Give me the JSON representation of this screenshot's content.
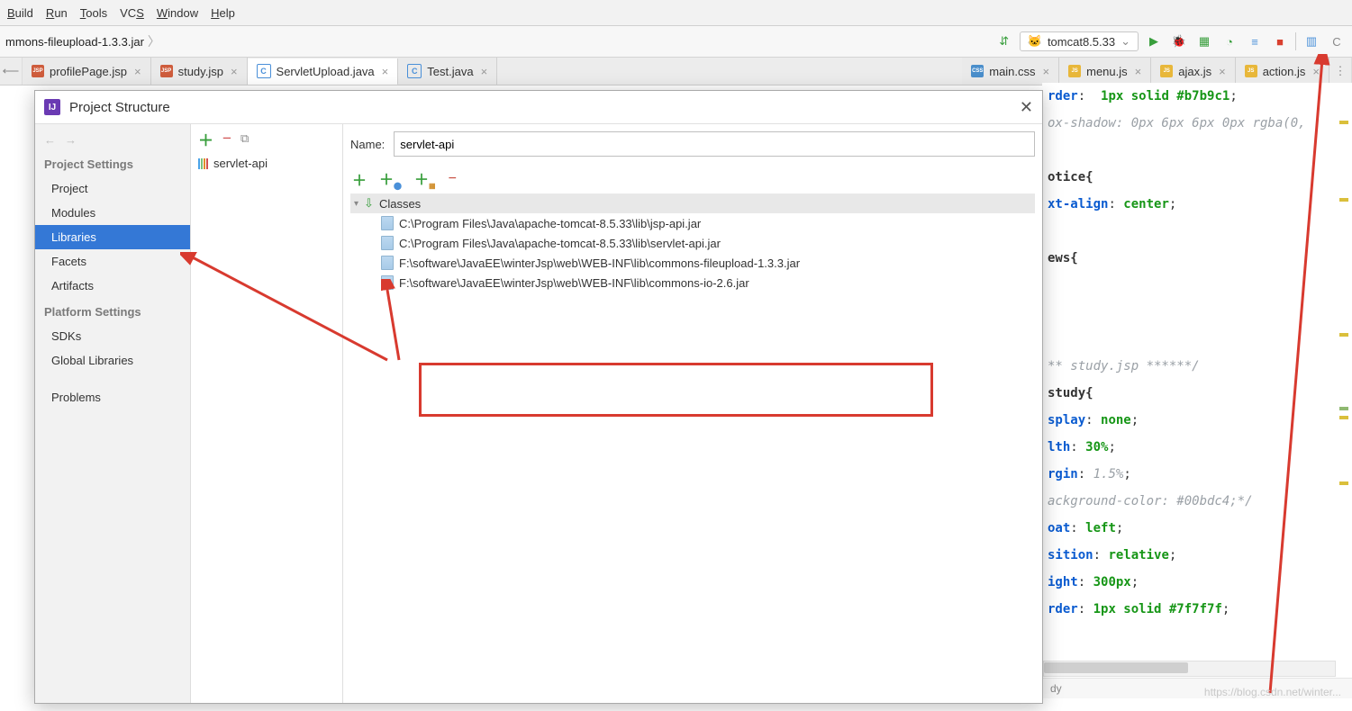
{
  "menu": {
    "items": [
      "Build",
      "Run",
      "Tools",
      "VCS",
      "Window",
      "Help"
    ]
  },
  "breadcrumb": {
    "segment": "mmons-fileupload-1.3.3.jar"
  },
  "runConfig": {
    "label": "tomcat8.5.33"
  },
  "tabs": [
    {
      "label": "profilePage.jsp",
      "type": "jsp",
      "active": false
    },
    {
      "label": "study.jsp",
      "type": "jsp",
      "active": false
    },
    {
      "label": "ServletUpload.java",
      "type": "java",
      "active": true
    },
    {
      "label": "Test.java",
      "type": "java",
      "active": false
    },
    {
      "label": "main.css",
      "type": "css",
      "active": false
    },
    {
      "label": "menu.js",
      "type": "js",
      "active": false
    },
    {
      "label": "ajax.js",
      "type": "js",
      "active": false
    },
    {
      "label": "action.js",
      "type": "js",
      "active": false
    }
  ],
  "editor": {
    "lines": [
      {
        "t": "css",
        "txt": "rder:  1px solid #b7b9c1;"
      },
      {
        "t": "com",
        "txt": "ox-shadow: 0px 6px 6px 0px rgba(0,"
      },
      {
        "t": "blank",
        "txt": ""
      },
      {
        "t": "sel",
        "txt": "otice{"
      },
      {
        "t": "css",
        "txt": "xt-align: center;"
      },
      {
        "t": "blank",
        "txt": ""
      },
      {
        "t": "sel",
        "txt": "ews{"
      },
      {
        "t": "blank",
        "txt": ""
      },
      {
        "t": "blank",
        "txt": ""
      },
      {
        "t": "blank",
        "txt": ""
      },
      {
        "t": "com",
        "txt": "** study.jsp ******/"
      },
      {
        "t": "sel",
        "txt": "study{"
      },
      {
        "t": "css",
        "txt": "splay: none;"
      },
      {
        "t": "css",
        "txt": "lth: 30%;"
      },
      {
        "t": "cssi",
        "txt": "rgin: 1.5%;"
      },
      {
        "t": "com",
        "txt": "ackground-color: #00bdc4;*/"
      },
      {
        "t": "css",
        "txt": "oat: left;"
      },
      {
        "t": "csshl",
        "txt": "sition: relative;"
      },
      {
        "t": "css",
        "txt": "ight: 300px;"
      },
      {
        "t": "css",
        "txt": "rder: 1px solid #7f7f7f;"
      }
    ],
    "status": "dy"
  },
  "dialog": {
    "title": "Project Structure",
    "nav": {
      "group1": "Project Settings",
      "items1": [
        "Project",
        "Modules",
        "Libraries",
        "Facets",
        "Artifacts"
      ],
      "selected": "Libraries",
      "group2": "Platform Settings",
      "items2": [
        "SDKs",
        "Global Libraries"
      ],
      "group3": "",
      "items3": [
        "Problems"
      ]
    },
    "library": {
      "listItem": "servlet-api",
      "nameLabel": "Name:",
      "nameValue": "servlet-api",
      "classesHeader": "Classes",
      "files": [
        "C:\\Program Files\\Java\\apache-tomcat-8.5.33\\lib\\jsp-api.jar",
        "C:\\Program Files\\Java\\apache-tomcat-8.5.33\\lib\\servlet-api.jar",
        "F:\\software\\JavaEE\\winterJsp\\web\\WEB-INF\\lib\\commons-fileupload-1.3.3.jar",
        "F:\\software\\JavaEE\\winterJsp\\web\\WEB-INF\\lib\\commons-io-2.6.jar"
      ]
    }
  },
  "watermark": "https://blog.csdn.net/winter..."
}
